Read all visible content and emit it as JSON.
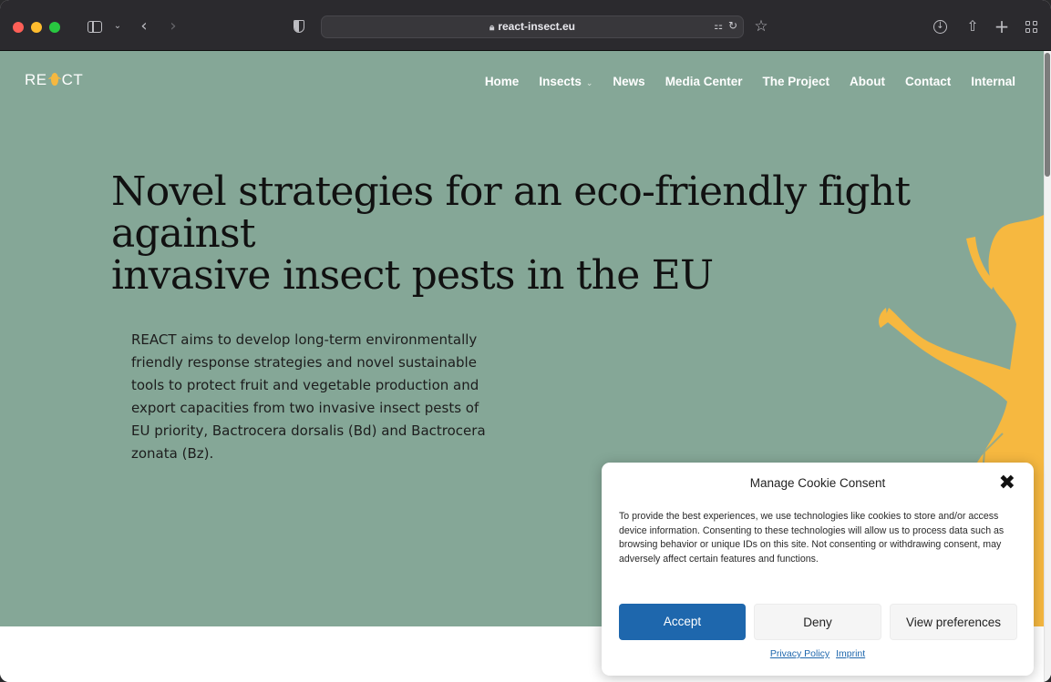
{
  "browser": {
    "url": "react-insect.eu"
  },
  "site": {
    "logo": "RE CT",
    "nav": [
      {
        "label": "Home",
        "dropdown": false
      },
      {
        "label": "Insects",
        "dropdown": true
      },
      {
        "label": "News",
        "dropdown": false
      },
      {
        "label": "Media Center",
        "dropdown": false
      },
      {
        "label": "The Project",
        "dropdown": false
      },
      {
        "label": "About",
        "dropdown": false
      },
      {
        "label": "Contact",
        "dropdown": false
      },
      {
        "label": "Internal",
        "dropdown": false
      }
    ],
    "hero": {
      "title_line1": "Novel strategies for an eco-friendly fight against",
      "title_line2": "invasive insect pests in the EU",
      "text": "REACT aims to develop long-term environmentally friendly response strategies and novel sustainable tools to protect fruit and vegetable production and export capacities from two invasive insect pests of EU priority, Bactrocera dorsalis (Bd) and Bactrocera zonata (Bz)."
    },
    "colors": {
      "hero_bg": "#85a797",
      "accent_yellow": "#f6b840",
      "accept_blue": "#1e67ad"
    }
  },
  "cookie": {
    "title": "Manage Cookie Consent",
    "close": "✖",
    "body": "To provide the best experiences, we use technologies like cookies to store and/or access device information. Consenting to these technologies will allow us to process data such as browsing behavior or unique IDs on this site. Not consenting or withdrawing consent, may adversely affect certain features and functions.",
    "accept": "Accept",
    "deny": "Deny",
    "preferences": "View preferences",
    "privacy_policy": "Privacy Policy",
    "imprint": "Imprint"
  }
}
